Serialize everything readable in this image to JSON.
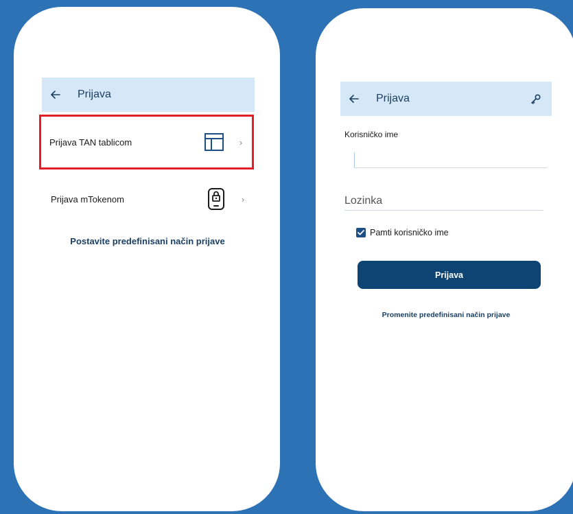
{
  "colors": {
    "background": "#2e72b6",
    "appbar": "#d6e8f7",
    "primary_dark": "#0d4473",
    "highlight_border": "#e31e24"
  },
  "left_screen": {
    "appbar": {
      "back_icon": "arrow-left-icon",
      "title": "Prijava"
    },
    "options": [
      {
        "label": "Prijava TAN tablicom",
        "icon": "table-icon",
        "chevron": "›",
        "highlighted": true
      },
      {
        "label": "Prijava mTokenom",
        "icon": "phone-lock-icon",
        "chevron": "›",
        "highlighted": false
      }
    ],
    "default_method_link": "Postavite predefinisani način prijave"
  },
  "right_screen": {
    "appbar": {
      "back_icon": "arrow-left-icon",
      "title": "Prijava",
      "action_icon": "key-icon"
    },
    "username": {
      "label": "Korisničko ime",
      "value": ""
    },
    "password": {
      "placeholder": "Lozinka",
      "value": ""
    },
    "remember": {
      "label": "Pamti korisničko ime",
      "checked": true
    },
    "login_button": "Prijava",
    "change_method_link": "Promenite predefinisani način prijave"
  }
}
